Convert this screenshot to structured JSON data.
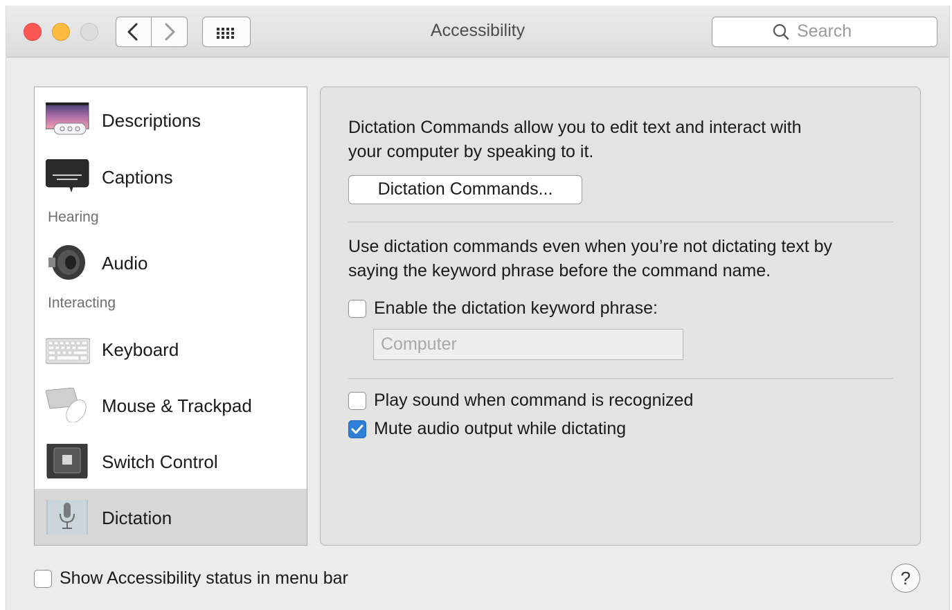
{
  "window": {
    "title": "Accessibility",
    "search": {
      "placeholder": "Search",
      "icon": "magnifier"
    }
  },
  "sidebar": {
    "items": [
      {
        "label": "Descriptions",
        "icon": "descriptions-icon"
      },
      {
        "label": "Captions",
        "icon": "captions-icon"
      },
      {
        "label": "Audio",
        "icon": "speaker-icon"
      },
      {
        "label": "Keyboard",
        "icon": "keyboard-icon"
      },
      {
        "label": "Mouse & Trackpad",
        "icon": "mouse-icon"
      },
      {
        "label": "Switch Control",
        "icon": "switch-control-icon"
      },
      {
        "label": "Dictation",
        "icon": "microphone-icon",
        "selected": true
      }
    ],
    "sections": {
      "hearing": "Hearing",
      "interacting": "Interacting"
    }
  },
  "main": {
    "intro_line1": "Dictation Commands allow you to edit text and interact with",
    "intro_line2": "your computer by speaking to it.",
    "commands_button": "Dictation Commands...",
    "keyword_line1": "Use dictation commands even when you’re not dictating text by",
    "keyword_line2": "saying the keyword phrase before the command name.",
    "enable_keyword": {
      "label": "Enable the dictation keyword phrase:",
      "checked": false
    },
    "keyword_field": {
      "placeholder": "Computer",
      "value": ""
    },
    "play_sound": {
      "label": "Play sound when command is recognized",
      "checked": false
    },
    "mute_audio": {
      "label": "Mute audio output while dictating",
      "checked": true
    }
  },
  "footer": {
    "show_status": {
      "label": "Show Accessibility status in menu bar",
      "checked": false
    },
    "help": "?"
  },
  "colors": {
    "accent": "#2f7ed8",
    "close": "#fc5753",
    "minimize": "#fdbc40"
  }
}
